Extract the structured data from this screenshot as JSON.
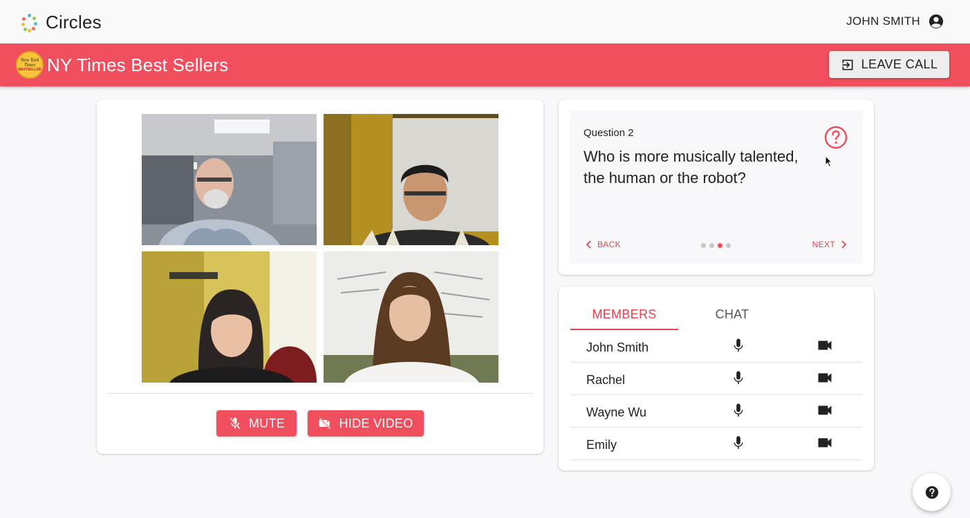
{
  "app": {
    "title": "Circles",
    "user_name": "JOHN SMITH"
  },
  "group": {
    "title": "NY Times Best Sellers",
    "badge_text": "New York Times",
    "badge_sub": "BESTSELLER",
    "leave_label": "LEAVE CALL"
  },
  "video": {
    "mute_label": "MUTE",
    "hide_video_label": "HIDE VIDEO"
  },
  "question": {
    "number": "Question 2",
    "text": "Who is more musically talented, the human or the robot?",
    "back_label": "BACK",
    "next_label": "NEXT",
    "current_page": 3,
    "total_pages": 4
  },
  "members": {
    "tabs": [
      "MEMBERS",
      "CHAT"
    ],
    "active_tab": "MEMBERS",
    "list": [
      {
        "name": "John Smith"
      },
      {
        "name": "Rachel"
      },
      {
        "name": "Wayne Wu"
      },
      {
        "name": "Emily"
      }
    ]
  },
  "icons": {
    "user": "account-circle-icon",
    "leave": "exit-icon",
    "mute": "mic-off-icon",
    "hide_video": "videocam-off-icon",
    "help": "help-circle-icon",
    "mic": "mic-icon",
    "cam": "videocam-icon"
  },
  "colors": {
    "accent": "#f14f5d",
    "accent_text": "#e5414f",
    "background": "#f8f7f9"
  }
}
